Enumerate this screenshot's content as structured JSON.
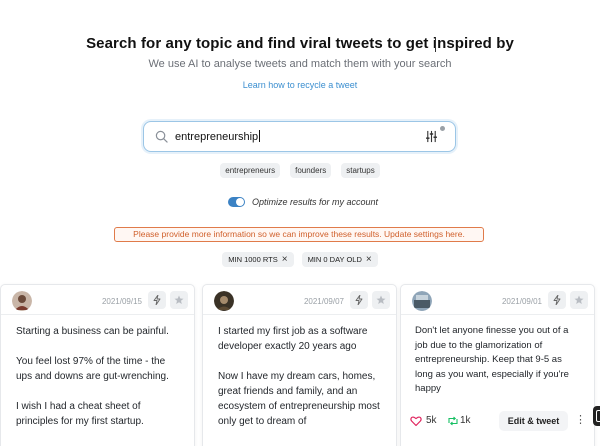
{
  "hero": {
    "title": "Search for any topic and find viral tweets to get inspired by",
    "subtitle": "We use AI to analyse tweets and match them with your search",
    "learn_link": "Learn how to recycle a tweet"
  },
  "search": {
    "value": "entrepreneurship",
    "icon": "search-icon",
    "settings_icon": "sliders-icon"
  },
  "suggestions": [
    "entrepreneurs",
    "founders",
    "startups"
  ],
  "optimize": {
    "label": "Optimize results for my account",
    "enabled": true
  },
  "warning_text": "Please provide more information so we can improve these results. Update settings here.",
  "active_filters": [
    "MIN 1000 RTS",
    "MIN 0 DAY OLD"
  ],
  "colors": {
    "accent": "#3b82c4",
    "warning": "#d0602c",
    "like": "#e0245e",
    "retweet": "#17bf63"
  },
  "cards": [
    {
      "date": "2021/09/15",
      "text": "Starting a business can be painful.\n\nYou feel lost 97% of the time - the ups and downs are gut-wrenching.\n\nI wish I had a cheat sheet of principles for my first startup."
    },
    {
      "date": "2021/09/07",
      "text": "I started my first job as a software developer exactly 20 years ago\n\nNow I have my dream cars, homes, great friends and family, and an ecosystem of entrepreneurship most only get to dream of"
    },
    {
      "date": "2021/09/01",
      "text": "Don't let anyone finesse you out of a job due to the glamorization of entrepreneurship. Keep that 9-5 as long as you want, especially if you're happy",
      "likes": "5k",
      "retweets": "1k",
      "edit_label": "Edit & tweet",
      "more_label": "⋮"
    }
  ]
}
